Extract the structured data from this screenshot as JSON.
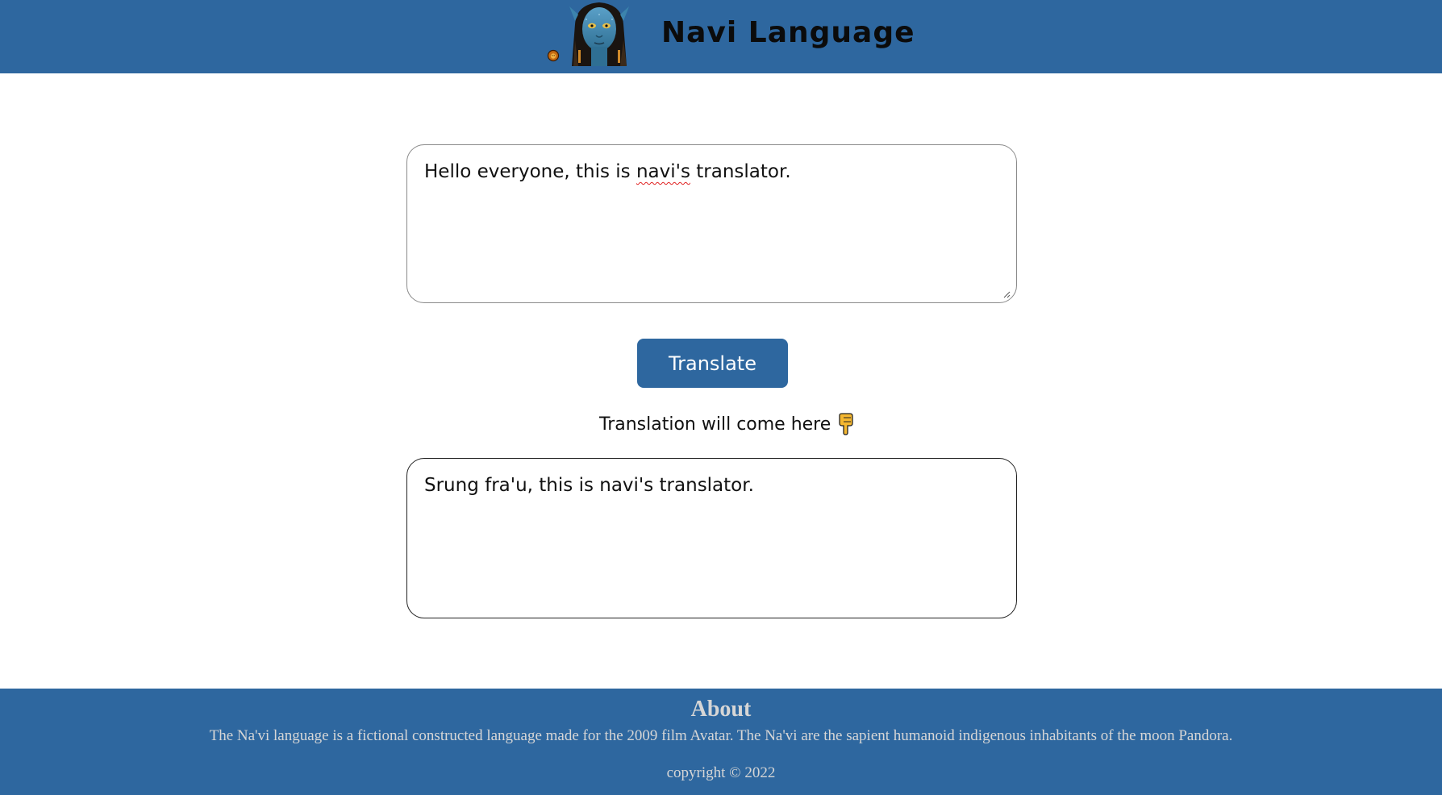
{
  "header": {
    "title": "Navi  Language",
    "logo_icon": "navi-avatar-face",
    "small_icon": "lion-emblem-icon",
    "background": "#2e679f"
  },
  "input": {
    "text_before": "Hello everyone, this is ",
    "text_misspelled": "navi's",
    "text_after": " translator."
  },
  "translate_button": {
    "label": "Translate",
    "background": "#2e679f"
  },
  "hint": {
    "text": "Translation will come here",
    "icon": "pointing-down-hand-icon"
  },
  "output": {
    "text": "Srung fra'u, this is navi's translator."
  },
  "footer": {
    "about_title": "About",
    "about_text": "The Na'vi language is a fictional constructed language made for the 2009 film Avatar. The Na'vi are the sapient humanoid indigenous inhabitants of the moon Pandora.",
    "copyright": "copyright © 2022"
  }
}
